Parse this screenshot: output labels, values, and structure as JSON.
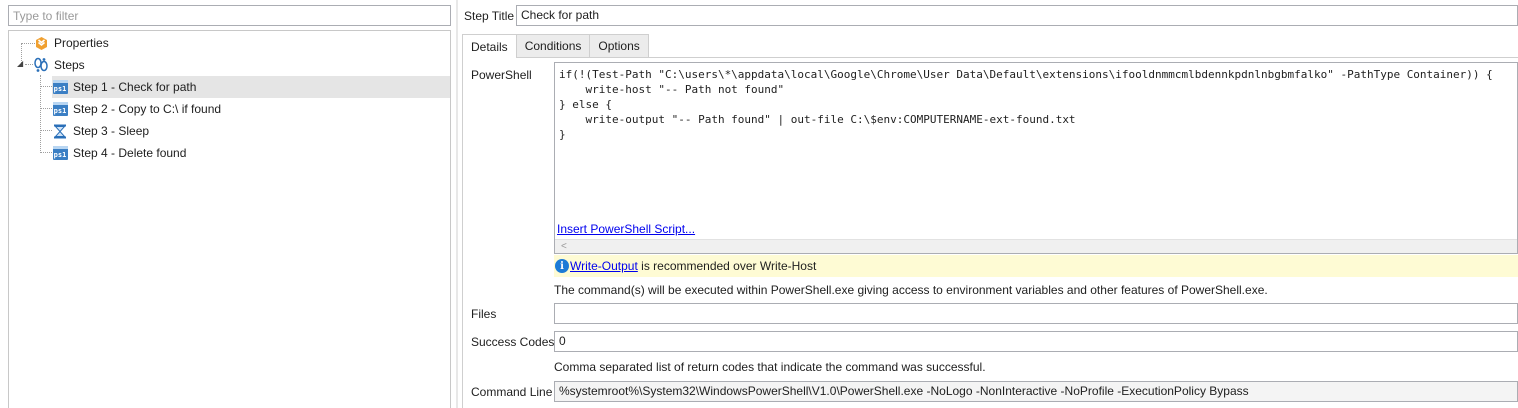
{
  "filter": {
    "placeholder": "Type to filter"
  },
  "tree": {
    "properties": {
      "label": "Properties",
      "icon": "settings-properties-icon"
    },
    "steps": {
      "label": "Steps",
      "icon": "steps-footprints-icon",
      "items": [
        {
          "label": "Step 1 - Check for path",
          "icon": "powershell-icon",
          "selected": true
        },
        {
          "label": "Step 2 - Copy to C:\\ if found",
          "icon": "powershell-icon"
        },
        {
          "label": "Step 3 - Sleep",
          "icon": "hourglass-icon"
        },
        {
          "label": "Step 4 - Delete found",
          "icon": "powershell-icon"
        }
      ]
    }
  },
  "ps_icon_text": "ps1",
  "step_title": {
    "label": "Step Title",
    "value": "Check for path"
  },
  "tabs": [
    {
      "label": "Details",
      "active": true
    },
    {
      "label": "Conditions"
    },
    {
      "label": "Options"
    }
  ],
  "powershell": {
    "label": "PowerShell",
    "script": "if(!(Test-Path \"C:\\users\\*\\appdata\\local\\Google\\Chrome\\User Data\\Default\\extensions\\ifooldnmmcmlbdennkpdnlnbgbmfalko\" -PathType Container)) {\n    write-host \"-- Path not found\"\n} else {\n    write-output \"-- Path found\" | out-file C:\\$env:COMPUTERNAME-ext-found.txt\n}",
    "insert_link": "Insert PowerShell Script...",
    "scroll_arrow": "<",
    "info_link": "Write-Output",
    "info_text": " is recommended over Write-Host",
    "description": "The command(s) will be executed within PowerShell.exe giving access to environment variables and other features of PowerShell.exe."
  },
  "files": {
    "label": "Files",
    "value": ""
  },
  "success_codes": {
    "label": "Success Codes",
    "value": "0",
    "description": "Comma separated list of return codes that indicate the command was successful."
  },
  "command_line": {
    "label": "Command Line",
    "value": "%systemroot%\\System32\\WindowsPowerShell\\V1.0\\PowerShell.exe -NoLogo -NonInteractive -NoProfile -ExecutionPolicy Bypass"
  },
  "colors": {
    "selection": "#e5e5e5",
    "info_background": "#fefbd4",
    "link": "#0000ee",
    "info_icon": "#1c7bd6",
    "powershell_icon": "#3b7fc4",
    "properties_icon": "#f0a030",
    "steps_icon": "#2a6fb8"
  }
}
